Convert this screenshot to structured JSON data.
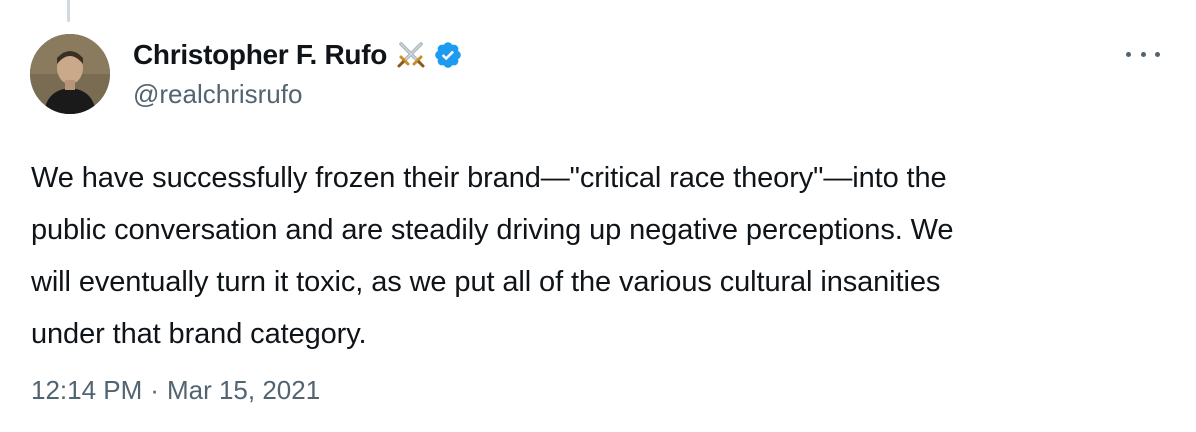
{
  "tweet": {
    "author": {
      "display_name": "Christopher F. Rufo",
      "handle": "@realchrisrufo",
      "emoji_icon": "crossed-swords-icon",
      "verified_icon": "verified-badge-icon",
      "verified_color": "#1d9bf0"
    },
    "more_icon": "more-options-icon",
    "text_lines": [
      "We have successfully frozen their brand—\"critical race theory\"—into the",
      "public conversation and are steadily driving up negative perceptions. We",
      "will eventually turn it toxic, as we put all of the various cultural insanities",
      "under that brand category."
    ],
    "time": "12:14 PM",
    "separator": "·",
    "date": "Mar 15, 2021"
  }
}
